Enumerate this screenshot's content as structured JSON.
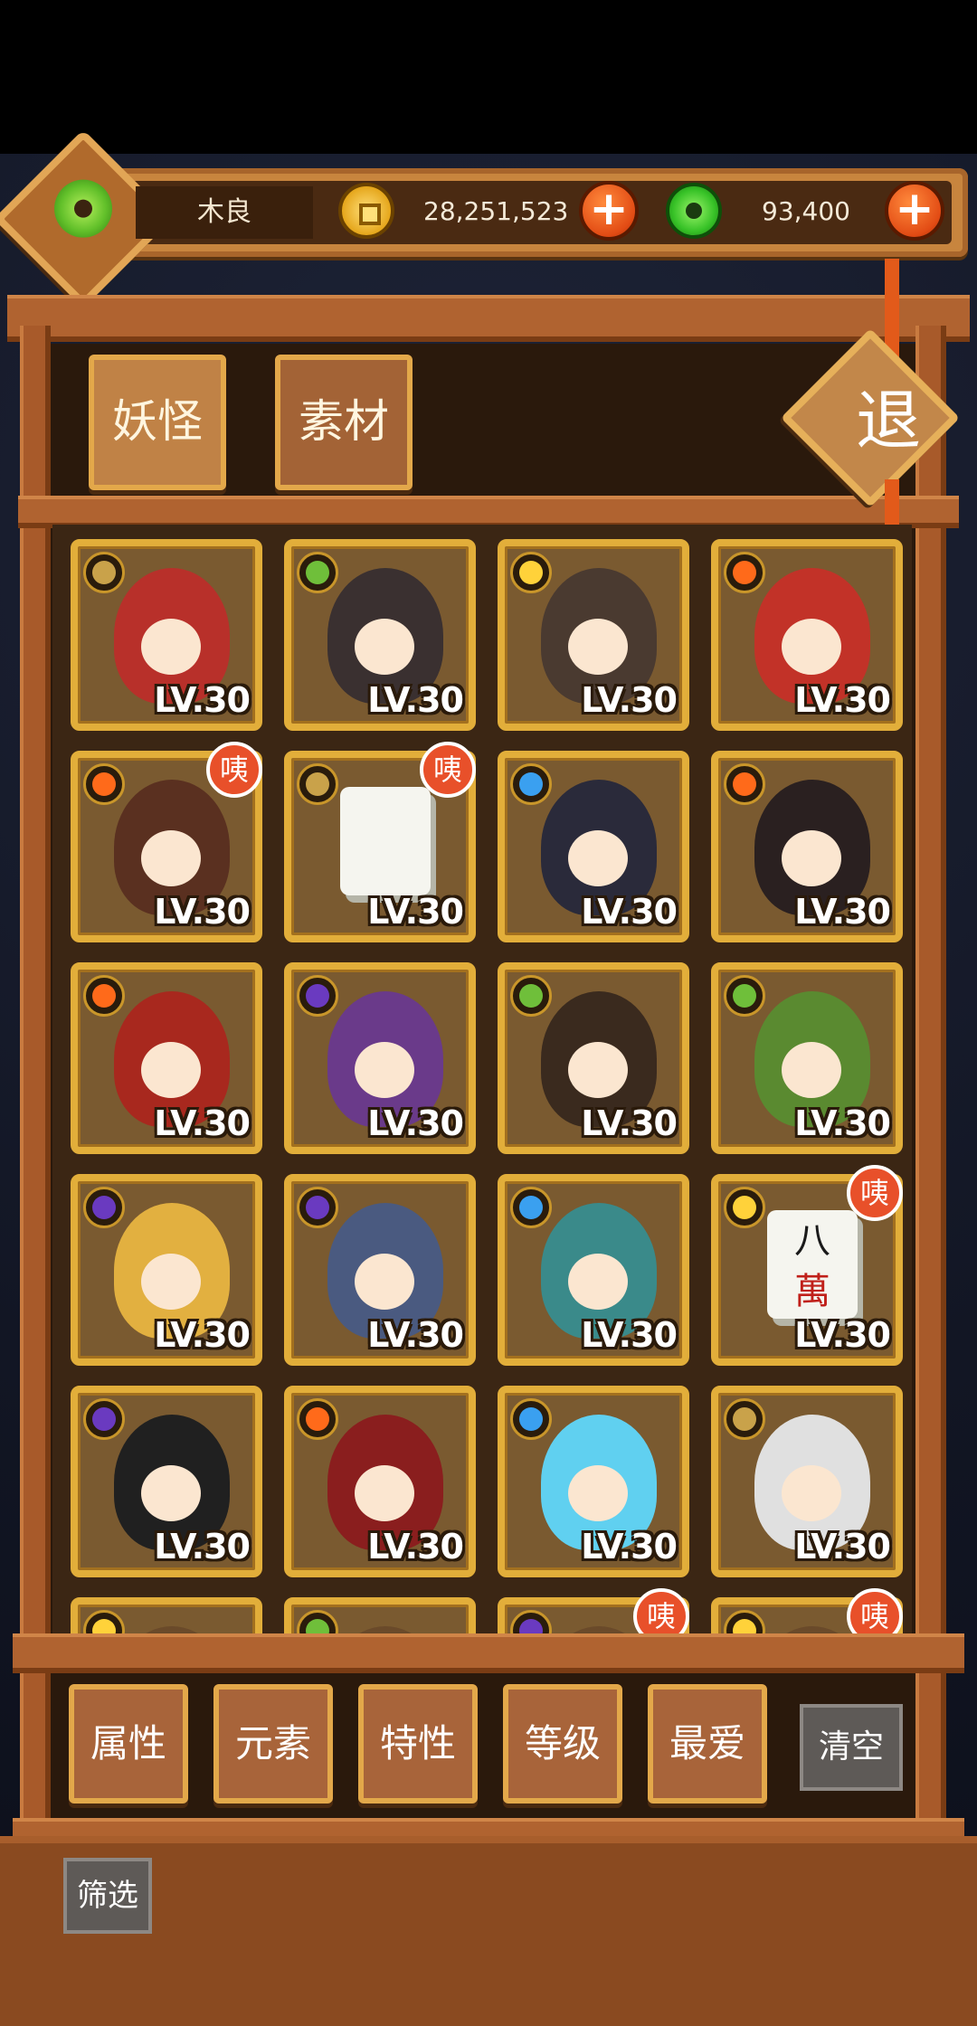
{
  "player": {
    "name": "木良"
  },
  "currency": {
    "gold": {
      "icon": "gold-coin-icon",
      "amount": "28,251,523"
    },
    "jade": {
      "icon": "jade-coin-icon",
      "amount": "93,400"
    },
    "add_label": "+"
  },
  "tabs": [
    {
      "label": "妖怪"
    },
    {
      "label": "素材"
    }
  ],
  "exit_label": "退",
  "monsters": [
    {
      "element": "earth",
      "level": "LV.30",
      "badge": ""
    },
    {
      "element": "wood",
      "level": "LV.30",
      "badge": ""
    },
    {
      "element": "light",
      "level": "LV.30",
      "badge": ""
    },
    {
      "element": "fire",
      "level": "LV.30",
      "badge": ""
    },
    {
      "element": "fire",
      "level": "LV.30",
      "badge": "咦"
    },
    {
      "element": "earth",
      "level": "LV.30",
      "badge": "咦"
    },
    {
      "element": "water",
      "level": "LV.30",
      "badge": ""
    },
    {
      "element": "fire",
      "level": "LV.30",
      "badge": ""
    },
    {
      "element": "fire",
      "level": "LV.30",
      "badge": ""
    },
    {
      "element": "dark",
      "level": "LV.30",
      "badge": ""
    },
    {
      "element": "wood",
      "level": "LV.30",
      "badge": ""
    },
    {
      "element": "wood",
      "level": "LV.30",
      "badge": ""
    },
    {
      "element": "dark",
      "level": "LV.30",
      "badge": ""
    },
    {
      "element": "dark",
      "level": "LV.30",
      "badge": ""
    },
    {
      "element": "water",
      "level": "LV.30",
      "badge": ""
    },
    {
      "element": "light",
      "level": "LV.30",
      "badge": "咦"
    },
    {
      "element": "dark",
      "level": "LV.30",
      "badge": ""
    },
    {
      "element": "fire",
      "level": "LV.30",
      "badge": ""
    },
    {
      "element": "water",
      "level": "LV.30",
      "badge": ""
    },
    {
      "element": "earth",
      "level": "LV.30",
      "badge": ""
    },
    {
      "element": "light",
      "level": "",
      "badge": ""
    },
    {
      "element": "wood",
      "level": "",
      "badge": ""
    },
    {
      "element": "dark",
      "level": "",
      "badge": "咦"
    },
    {
      "element": "light",
      "level": "",
      "badge": "咦"
    }
  ],
  "tile_text": "八\n萬",
  "filters": [
    {
      "label": "属性"
    },
    {
      "label": "元素"
    },
    {
      "label": "特性"
    },
    {
      "label": "等级"
    },
    {
      "label": "最爱"
    }
  ],
  "clear_label": "清空",
  "screen_label": "筛选",
  "element_colors": {
    "earth": "#c9a24a",
    "wood": "#6fbf3a",
    "light": "#ffd23a",
    "fire": "#ff6a1a",
    "water": "#3aa0f0",
    "dark": "#6a3ac0"
  },
  "portrait_colors": [
    "#b8302a",
    "#3a3030",
    "#4a3a30",
    "#c23228",
    "#5a3020",
    "#f0f0ea",
    "#2a2a3a",
    "#2a2020",
    "#a8281e",
    "#6a3a8a",
    "#3a2a1e",
    "#5a8a30",
    "#e2b040",
    "#4a5a80",
    "#3a8a8a",
    "#f0f0ea",
    "#202020",
    "#8a1e1e",
    "#60d0f0",
    "#e0e0e0",
    "#6a4a2a",
    "#6a4a2a",
    "#6a4a2a",
    "#6a4a2a"
  ]
}
